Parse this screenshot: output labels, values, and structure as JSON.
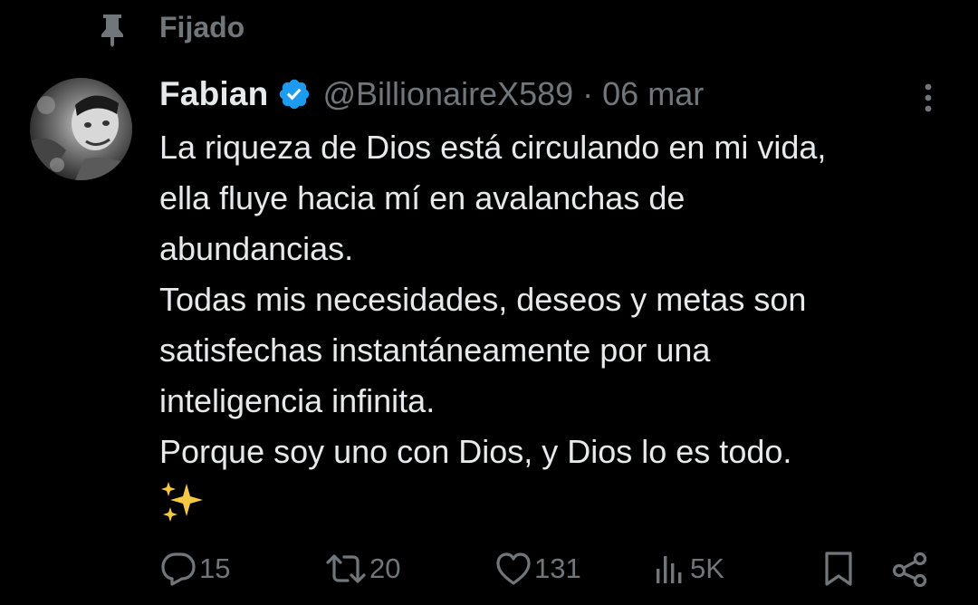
{
  "pinned": {
    "label": "Fijado",
    "icon": "pin-icon"
  },
  "tweet": {
    "author": {
      "display_name": "Fabian",
      "handle": "@BillionaireX589",
      "verified": true,
      "verified_color": "#1d9bf0"
    },
    "separator": "·",
    "date": "06 mar",
    "body_lines": [
      "La riqueza de Dios está circulando en mi vida,",
      "ella fluye hacia mí en avalanchas de",
      "abundancias.",
      "Todas mis necesidades, deseos y metas son",
      "satisfechas instantáneamente por una",
      "inteligencia infinita.",
      "Porque soy uno con Dios, y Dios lo es todo."
    ],
    "emoji": "sparkles",
    "actions": {
      "reply": {
        "icon": "reply-icon",
        "count": "15"
      },
      "retweet": {
        "icon": "retweet-icon",
        "count": "20"
      },
      "like": {
        "icon": "heart-icon",
        "count": "131"
      },
      "views": {
        "icon": "views-icon",
        "count": "5K"
      },
      "bookmark": {
        "icon": "bookmark-icon"
      },
      "share": {
        "icon": "share-icon"
      }
    }
  },
  "colors": {
    "background": "#000000",
    "text_primary": "#e7e9ea",
    "text_secondary": "#71767b",
    "verified": "#1d9bf0",
    "sparkle": "#f5c843"
  }
}
